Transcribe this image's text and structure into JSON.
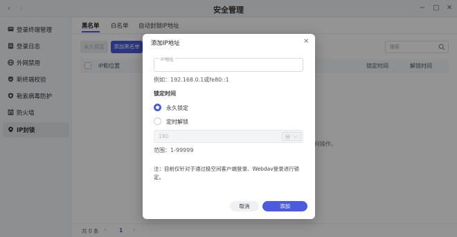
{
  "window": {
    "title": "安全管理",
    "back_icon": "‹",
    "forward_icon": "›",
    "minimize_icon": "−",
    "maximize_icon": "□",
    "close_icon": "✕"
  },
  "sidebar": {
    "items": [
      {
        "label": "登录终端管理",
        "icon": "terminal-icon"
      },
      {
        "label": "登录日志",
        "icon": "log-icon"
      },
      {
        "label": "外网禁用",
        "icon": "globe-icon"
      },
      {
        "label": "新终端校验",
        "icon": "shield-check-icon"
      },
      {
        "label": "勒索病毒防护",
        "icon": "virus-shield-icon"
      },
      {
        "label": "防火墙",
        "icon": "firewall-icon"
      },
      {
        "label": "IP封锁",
        "icon": "ip-block-icon",
        "active": true
      }
    ]
  },
  "tabs": [
    {
      "label": "黑名单",
      "active": true
    },
    {
      "label": "白名单"
    },
    {
      "label": "自动封锁IP地址"
    }
  ],
  "toolbar": {
    "lock_label": "永久锁定",
    "add_label": "添加黑名单",
    "search_placeholder": "搜索"
  },
  "table": {
    "columns": [
      "IP和位置",
      "锁定时间",
      "解锁时间"
    ],
    "empty_partial": "何操作。"
  },
  "footer": {
    "total": "共 0 条",
    "page": "1",
    "prev_icon": "‹",
    "next_icon": "›"
  },
  "dialog": {
    "title": "添加IP地址",
    "close_icon": "×",
    "ip_label": "IP地址",
    "ip_value": "",
    "example": "例如：192.168.0.1或fe80::1",
    "lock_time_label": "锁定时间",
    "option_permanent": "永久锁定",
    "option_timed": "定时解锁",
    "selected_option": "permanent",
    "minutes_value": "180",
    "unit": "分",
    "unit_chevron": "⌵",
    "range": "范围：1-99999",
    "note": "注：目前仅针对于通过极空间客户端登录、Webdav登录进行锁定。",
    "cancel_label": "取消",
    "confirm_label": "添加"
  },
  "colors": {
    "accent": "#4a5bdc",
    "overlay": "rgba(0,0,0,0.42)"
  }
}
